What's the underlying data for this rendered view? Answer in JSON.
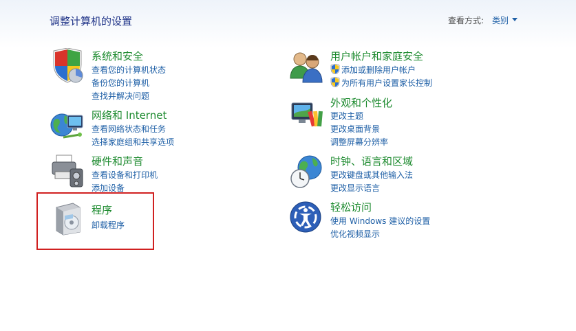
{
  "page_title": "调整计算机的设置",
  "view_by": {
    "label": "查看方式:",
    "value": "类别"
  },
  "categories": {
    "system": {
      "title": "系统和安全",
      "icon": "shield-security-icon",
      "links": [
        "查看您的计算机状态",
        "备份您的计算机",
        "查找并解决问题"
      ]
    },
    "network": {
      "title": "网络和 Internet",
      "icon": "network-globe-icon",
      "links": [
        "查看网络状态和任务",
        "选择家庭组和共享选项"
      ]
    },
    "hardware": {
      "title": "硬件和声音",
      "icon": "printer-hardware-icon",
      "links": [
        "查看设备和打印机",
        "添加设备"
      ]
    },
    "programs": {
      "title": "程序",
      "icon": "programs-box-icon",
      "links": [
        "卸载程序"
      ]
    },
    "users": {
      "title": "用户帐户和家庭安全",
      "icon": "users-people-icon",
      "links": [
        "添加或删除用户帐户",
        "为所有用户设置家长控制"
      ]
    },
    "appearance": {
      "title": "外观和个性化",
      "icon": "monitor-palette-icon",
      "links": [
        "更改主题",
        "更改桌面背景",
        "调整屏幕分辨率"
      ]
    },
    "clock": {
      "title": "时钟、语言和区域",
      "icon": "clock-globe-icon",
      "links": [
        "更改键盘或其他输入法",
        "更改显示语言"
      ]
    },
    "ease": {
      "title": "轻松访问",
      "icon": "ease-of-access-icon",
      "links": [
        "使用 Windows 建议的设置",
        "优化视频显示"
      ]
    }
  },
  "colors": {
    "title_green": "#1c8a2e",
    "link_blue": "#1e5fa6",
    "highlight_red": "#d02020"
  }
}
